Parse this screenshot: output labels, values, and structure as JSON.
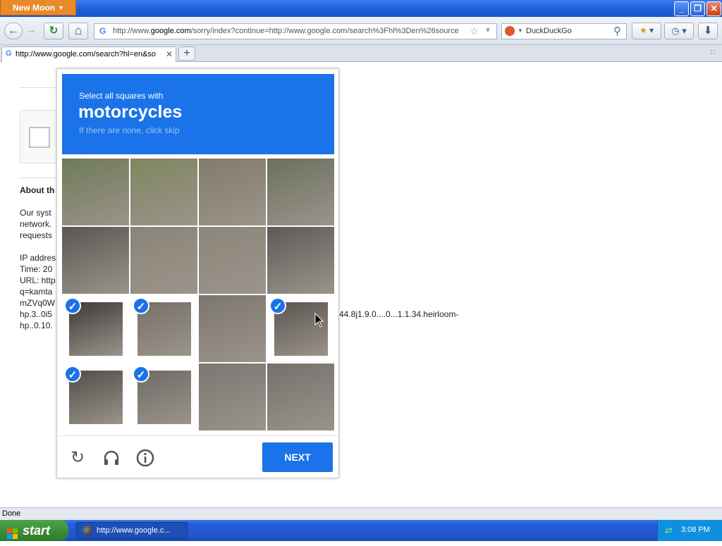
{
  "window": {
    "app_menu": "New Moon",
    "minimize": "_",
    "maximize": "❐",
    "close": "✕"
  },
  "toolbar": {
    "back": "←",
    "forward": "→",
    "reload": "↻",
    "home": "⌂",
    "url_prefix": "http://www.",
    "url_host": "google.com",
    "url_rest": "/sorry/index?continue=http://www.google.com/search%3Fhl%3Den%26source",
    "search_engine": "DuckDuckGo",
    "search_icon": "search-icon"
  },
  "tabs": [
    {
      "label": "http://www.google.com/search?hl=en&so",
      "close": "✕"
    }
  ],
  "new_tab": "+",
  "page": {
    "about_heading": "About th",
    "body_lines": [
      "Our syst",
      "network.",
      "requests"
    ],
    "info_lines": [
      "IP addres",
      "Time: 20",
      "URL: http",
      "q=kamta",
      "mZVq0W",
      "hp.3..0i5",
      "hp..0.10."
    ],
    "url_fragment": "44.8j1.9.0....0...1.1.34.heirloom-"
  },
  "captcha": {
    "instruction": "Select all squares with",
    "object": "motorcycles",
    "hint": "If there are none, click skip",
    "tiles": [
      {
        "selected": false
      },
      {
        "selected": false
      },
      {
        "selected": false
      },
      {
        "selected": false
      },
      {
        "selected": false
      },
      {
        "selected": false
      },
      {
        "selected": false
      },
      {
        "selected": false
      },
      {
        "selected": true
      },
      {
        "selected": true
      },
      {
        "selected": false
      },
      {
        "selected": true
      },
      {
        "selected": true
      },
      {
        "selected": true
      },
      {
        "selected": false
      },
      {
        "selected": false
      }
    ],
    "reload_icon": "reload-icon",
    "audio_icon": "headphones-icon",
    "info_icon": "info-icon",
    "next_label": "NEXT",
    "accent": "#1a73e8"
  },
  "status": {
    "text": "Done"
  },
  "taskbar": {
    "start": "start",
    "task_label": "http://www.google.c...",
    "clock": "3:08 PM"
  }
}
